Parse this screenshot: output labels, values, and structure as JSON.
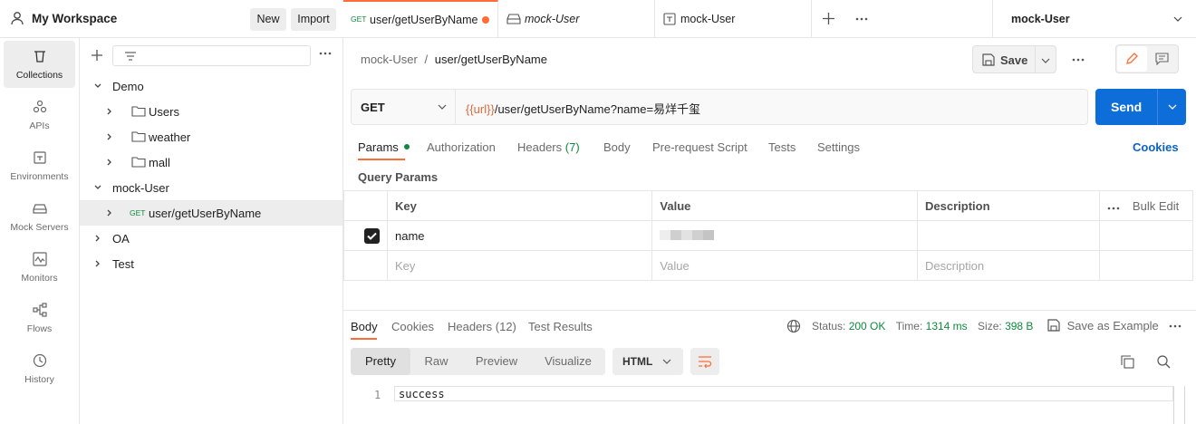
{
  "workspace": {
    "title": "My Workspace",
    "new_label": "New",
    "import_label": "Import"
  },
  "nav": [
    {
      "label": "Collections",
      "icon": "trash-bin-icon"
    },
    {
      "label": "APIs",
      "icon": "apis-icon"
    },
    {
      "label": "Environments",
      "icon": "environments-icon"
    },
    {
      "label": "Mock Servers",
      "icon": "mock-server-icon"
    },
    {
      "label": "Monitors",
      "icon": "monitor-icon"
    },
    {
      "label": "Flows",
      "icon": "flows-icon"
    },
    {
      "label": "History",
      "icon": "history-icon"
    }
  ],
  "tree": {
    "items": [
      {
        "label": "Demo",
        "level": 0,
        "expanded": true
      },
      {
        "label": "Users",
        "level": 1,
        "type": "folder"
      },
      {
        "label": "weather",
        "level": 1,
        "type": "folder"
      },
      {
        "label": "mall",
        "level": 1,
        "type": "folder"
      },
      {
        "label": "mock-User",
        "level": 0,
        "expanded": true
      },
      {
        "label": "user/getUserByName",
        "level": 1,
        "type": "request",
        "method": "GET",
        "selected": true
      },
      {
        "label": "OA",
        "level": 0
      },
      {
        "label": "Test",
        "level": 0
      }
    ]
  },
  "tabs": [
    {
      "method": "GET",
      "label": "user/getUserByName",
      "active": true,
      "unsaved": true
    },
    {
      "label": "mock-User",
      "icon": "mock-server-icon"
    },
    {
      "label": "mock-User",
      "icon": "environment-icon"
    }
  ],
  "environment": {
    "selected": "mock-User"
  },
  "breadcrumb": {
    "collection": "mock-User",
    "separator": "/",
    "request": "user/getUserByName"
  },
  "toolbar": {
    "save_label": "Save"
  },
  "request": {
    "method": "GET",
    "url_var": "{{url}}",
    "url_rest": "/user/getUserByName?name=易烊千玺",
    "send_label": "Send"
  },
  "request_tabs": {
    "params": "Params",
    "authorization": "Authorization",
    "headers": "Headers",
    "headers_count": "(7)",
    "body": "Body",
    "prerequest": "Pre-request Script",
    "tests": "Tests",
    "settings": "Settings",
    "cookies": "Cookies"
  },
  "query_params": {
    "title": "Query Params",
    "headers": {
      "key": "Key",
      "value": "Value",
      "description": "Description",
      "bulk_edit": "Bulk Edit"
    },
    "rows": [
      {
        "checked": true,
        "key": "name",
        "value_masked": true
      }
    ],
    "placeholders": {
      "key": "Key",
      "value": "Value",
      "description": "Description"
    }
  },
  "response": {
    "tabs": {
      "body": "Body",
      "cookies": "Cookies",
      "headers": "Headers",
      "headers_count": "(12)",
      "test_results": "Test Results"
    },
    "status_label": "Status:",
    "status_value": "200 OK",
    "time_label": "Time:",
    "time_value": "1314 ms",
    "size_label": "Size:",
    "size_value": "398 B",
    "save_example": "Save as Example",
    "views": [
      "Pretty",
      "Raw",
      "Preview",
      "Visualize"
    ],
    "format": "HTML",
    "line_number": "1",
    "body_text": "success"
  },
  "colors": {
    "accent": "#ff6c37",
    "send": "#0e6ed9",
    "get": "#0f8a3c",
    "status_ok": "#0f8a3c"
  }
}
